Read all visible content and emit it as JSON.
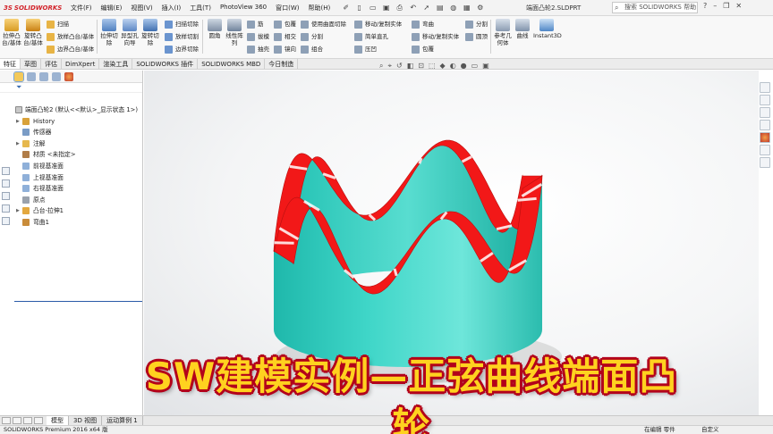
{
  "app": {
    "logo_text": "SOLIDWORKS",
    "menu": [
      "文件(F)",
      "编辑(E)",
      "视图(V)",
      "插入(I)",
      "工具(T)",
      "PhotoView 360",
      "窗口(W)",
      "帮助(H)"
    ],
    "document_title": "端面凸轮2.SLDPRT",
    "search_placeholder": "搜索 SOLIDWORKS 帮助",
    "window_controls": [
      "?",
      "–",
      "❐",
      "✕"
    ]
  },
  "commands": {
    "extrude_boss": "拉伸凸台/基体",
    "revolve_boss": "旋转凸台/基体",
    "sweep": "扫描",
    "loft": "放样凸台/基体",
    "boundary_boss": "边界凸台/基体",
    "extrude_cut": "拉伸切除",
    "hole_wizard": "异型孔向导",
    "revolve_cut": "旋转切除",
    "swept_cut": "扫描切除",
    "lofted_cut": "放样切割",
    "boundary_cut": "边界切除",
    "fillet": "圆角",
    "linear_pattern": "线性阵列",
    "rib": "筋",
    "draft": "拔模",
    "shell": "抽壳",
    "wrap": "包覆",
    "intersect": "相交",
    "mirror": "镜向",
    "use_surface": "使用曲面切除",
    "split": "分割",
    "combine": "组合",
    "move_copy": "移动/复制实体",
    "simple_hole": "简单直孔",
    "flex": "弯曲",
    "move_copy2": "移动/复制实体",
    "wrap2": "包覆",
    "split2": "分割",
    "dome": "圆顶",
    "ref_geometry": "参考几何体",
    "curves": "曲线",
    "instant3d": "Instant3D",
    "shape": "压凹",
    "offset": "包覆"
  },
  "tabs": [
    "特征",
    "草图",
    "评估",
    "DimXpert",
    "渲染工具",
    "SOLIDWORKS 插件",
    "SOLIDWORKS MBD",
    "今日制造"
  ],
  "feature_tree": {
    "root": "端面凸轮2 (默认<<默认>_显示状态 1>)",
    "items": [
      {
        "label": "History",
        "expandable": true
      },
      {
        "label": "传感器",
        "expandable": false
      },
      {
        "label": "注解",
        "expandable": true
      },
      {
        "label": "材质 <未指定>",
        "expandable": false
      },
      {
        "label": "前视基准面",
        "expandable": false
      },
      {
        "label": "上视基准面",
        "expandable": false
      },
      {
        "label": "右视基准面",
        "expandable": false
      },
      {
        "label": "原点",
        "expandable": false
      },
      {
        "label": "凸台-拉伸1",
        "expandable": true
      },
      {
        "label": "弯曲1",
        "expandable": false
      }
    ]
  },
  "sheet_tabs": [
    "模型",
    "3D 视图",
    "运动算例 1"
  ],
  "status": {
    "left": "SOLIDWORKS Premium 2016 x64 版",
    "mode": "在编辑 零件",
    "units": "自定义"
  },
  "caption": "SW建模实例—正弦曲线端面凸轮",
  "colors": {
    "cam_body": "#3fd6c8",
    "cam_top_face": "#f21818",
    "caption_fill": "#ffd21f",
    "caption_outline": "#b3001b"
  }
}
